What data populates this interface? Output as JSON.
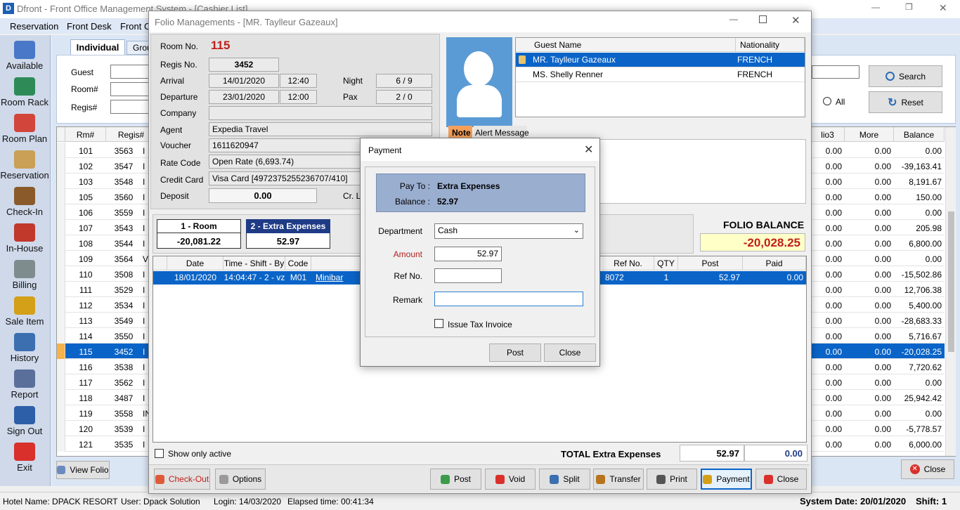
{
  "app": {
    "title": "Dfront - Front Office Management System - [Cashier List]",
    "menu": [
      "Reservation",
      "Front Desk",
      "Front C"
    ],
    "win_controls": {
      "min": "—",
      "restore": "❐",
      "close": "✕"
    }
  },
  "sidebar": [
    {
      "label": "Available",
      "color": "#4a78c8"
    },
    {
      "label": "Room Rack",
      "color": "#2e8b57"
    },
    {
      "label": "Room Plan",
      "color": "#d2453a"
    },
    {
      "label": "Reservation",
      "color": "#c9a055"
    },
    {
      "label": "Check-In",
      "color": "#8b5a2b"
    },
    {
      "label": "In-House",
      "color": "#c0392b"
    },
    {
      "label": "Billing",
      "color": "#7f8c8d"
    },
    {
      "label": "Sale Item",
      "color": "#d4a017"
    },
    {
      "label": "History",
      "color": "#3b6fb0"
    },
    {
      "label": "Report",
      "color": "#5a6f9a"
    },
    {
      "label": "Sign Out",
      "color": "#2d5fa8"
    },
    {
      "label": "Exit",
      "color": "#d9302c"
    }
  ],
  "cashier": {
    "tabs": [
      "Individual",
      "Grou"
    ],
    "filter_labels": [
      "Guest",
      "Room#",
      "Regis#"
    ],
    "all_label": "All",
    "search_label": "Search",
    "reset_label": "Reset",
    "left_cols": [
      "Rm#",
      "Regis#"
    ],
    "right_cols": [
      "lio3",
      "More",
      "Balance"
    ],
    "rows": [
      {
        "rm": "101",
        "regis": "3563",
        "c3": "I",
        "lio3": "0.00",
        "more": "0.00",
        "bal": "0.00"
      },
      {
        "rm": "102",
        "regis": "3547",
        "c3": "I",
        "lio3": "0.00",
        "more": "0.00",
        "bal": "-39,163.41"
      },
      {
        "rm": "103",
        "regis": "3548",
        "c3": "I",
        "lio3": "0.00",
        "more": "0.00",
        "bal": "8,191.67"
      },
      {
        "rm": "105",
        "regis": "3560",
        "c3": "I",
        "lio3": "0.00",
        "more": "0.00",
        "bal": "150.00"
      },
      {
        "rm": "106",
        "regis": "3559",
        "c3": "I",
        "lio3": "0.00",
        "more": "0.00",
        "bal": "0.00"
      },
      {
        "rm": "107",
        "regis": "3543",
        "c3": "I",
        "lio3": "0.00",
        "more": "0.00",
        "bal": "205.98"
      },
      {
        "rm": "108",
        "regis": "3544",
        "c3": "I",
        "lio3": "0.00",
        "more": "0.00",
        "bal": "6,800.00"
      },
      {
        "rm": "109",
        "regis": "3564",
        "c3": "V",
        "lio3": "0.00",
        "more": "0.00",
        "bal": "0.00"
      },
      {
        "rm": "110",
        "regis": "3508",
        "c3": "I",
        "lio3": "0.00",
        "more": "0.00",
        "bal": "-15,502.86"
      },
      {
        "rm": "111",
        "regis": "3529",
        "c3": "I",
        "lio3": "0.00",
        "more": "0.00",
        "bal": "12,706.38"
      },
      {
        "rm": "112",
        "regis": "3534",
        "c3": "I",
        "lio3": "0.00",
        "more": "0.00",
        "bal": "5,400.00"
      },
      {
        "rm": "113",
        "regis": "3549",
        "c3": "I",
        "lio3": "0.00",
        "more": "0.00",
        "bal": "-28,683.33"
      },
      {
        "rm": "114",
        "regis": "3550",
        "c3": "I",
        "lio3": "0.00",
        "more": "0.00",
        "bal": "5,716.67"
      },
      {
        "rm": "115",
        "regis": "3452",
        "c3": "I",
        "lio3": "0.00",
        "more": "0.00",
        "bal": "-20,028.25",
        "selected": true
      },
      {
        "rm": "116",
        "regis": "3538",
        "c3": "I",
        "lio3": "0.00",
        "more": "0.00",
        "bal": "7,720.62"
      },
      {
        "rm": "117",
        "regis": "3562",
        "c3": "I",
        "lio3": "0.00",
        "more": "0.00",
        "bal": "0.00"
      },
      {
        "rm": "118",
        "regis": "3487",
        "c3": "I",
        "lio3": "0.00",
        "more": "0.00",
        "bal": "25,942.42"
      },
      {
        "rm": "119",
        "regis": "3558",
        "c3": "IN",
        "lio3": "0.00",
        "more": "0.00",
        "bal": "0.00"
      },
      {
        "rm": "120",
        "regis": "3539",
        "c3": "I",
        "lio3": "0.00",
        "more": "0.00",
        "bal": "-5,778.57"
      },
      {
        "rm": "121",
        "regis": "3535",
        "c3": "I",
        "lio3": "0.00",
        "more": "0.00",
        "bal": "6,000.00"
      }
    ],
    "view_folio_label": "View Folio",
    "close_label": "Close"
  },
  "status": {
    "hotel": "Hotel Name: DPACK RESORT",
    "user": "User: Dpack Solution",
    "login": "Login: 14/03/2020",
    "elapsed": "Elapsed time: 00:41:34",
    "system_date": "System Date: 20/01/2020",
    "shift": "Shift: 1"
  },
  "folio": {
    "title": "Folio Managements - [MR. Taylleur Gazeaux]",
    "room_no_label": "Room No.",
    "room_no": "115",
    "regis_label": "Regis No.",
    "regis": "3452",
    "arrival_label": "Arrival",
    "arrival_date": "14/01/2020",
    "arrival_time": "12:40",
    "departure_label": "Departure",
    "departure_date": "23/01/2020",
    "departure_time": "12:00",
    "night_label": "Night",
    "night": "6 / 9",
    "pax_label": "Pax",
    "pax": "2 / 0",
    "company_label": "Company",
    "company": "",
    "agent_label": "Agent",
    "agent": "Expedia Travel",
    "voucher_label": "Voucher",
    "voucher": "1611620947",
    "rate_label": "Rate Code",
    "rate": "Open Rate (6,693.74)",
    "credit_label": "Credit Card",
    "credit": "Visa Card [4972375255236707/410]",
    "deposit_label": "Deposit",
    "deposit": "0.00",
    "cr_label": "Cr. Li",
    "guest_cols": [
      "Guest Name",
      "Nationality"
    ],
    "guests": [
      {
        "name": "MR. Taylleur Gazeaux",
        "nat": "FRENCH",
        "selected": true
      },
      {
        "name": "MS. Shelly Renner",
        "nat": "FRENCH"
      }
    ],
    "note_tab": "Note",
    "alert_tab": "Alert Message",
    "folios": [
      {
        "label": "1 - Room",
        "amount": "-20,081.22"
      },
      {
        "label": "2 - Extra Expenses",
        "amount": "52.97",
        "active": true
      }
    ],
    "balance_title": "FOLIO BALANCE",
    "balance": "-20,028.25",
    "tx_cols_left": [
      "Date",
      "Time - Shift - By",
      "Code"
    ],
    "tx_cols_right": [
      "Ref No.",
      "QTY",
      "Post",
      "Paid"
    ],
    "tx": [
      {
        "date": "18/01/2020",
        "time": "14:04:47 - 2 - vz",
        "code": "M01",
        "desc": "Minibar",
        "ref": "8072",
        "qty": "1",
        "post": "52.97",
        "paid": "0.00"
      }
    ],
    "show_active_label": "Show only active",
    "total_label": "TOTAL Extra Expenses",
    "total_post": "52.97",
    "total_paid": "0.00",
    "buttons": {
      "checkout": "Check-Out",
      "options": "Options",
      "post": "Post",
      "void": "Void",
      "split": "Split",
      "transfer": "Transfer",
      "print": "Print",
      "payment": "Payment",
      "close": "Close"
    }
  },
  "payment": {
    "title": "Payment",
    "pay_to_label": "Pay To :",
    "pay_to": "Extra Expenses",
    "balance_label": "Balance :",
    "balance": "52.97",
    "department_label": "Department",
    "department": "Cash",
    "amount_label": "Amount",
    "amount": "52.97",
    "ref_label": "Ref No.",
    "ref": "",
    "remark_label": "Remark",
    "remark": "",
    "tax_label": "Issue Tax Invoice",
    "post_label": "Post",
    "close_label": "Close"
  }
}
